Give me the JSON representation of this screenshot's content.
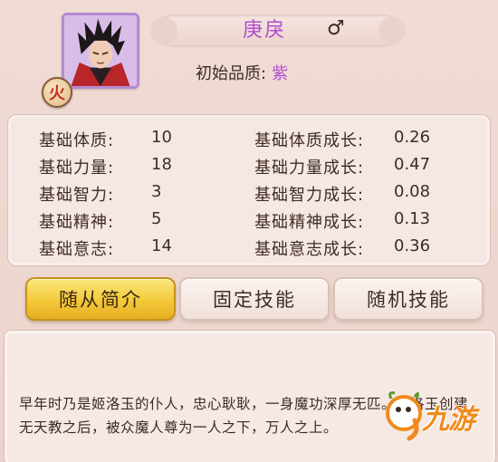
{
  "hero": {
    "name": "庚戾",
    "gender_symbol": "♂",
    "element_badge": "火",
    "quality_label": "初始品质:",
    "quality_value": "紫",
    "portrait_icon": "hero-portrait"
  },
  "stats": [
    {
      "label": "基础体质:",
      "value": "10",
      "growth_label": "基础体质成长:",
      "growth_value": "0.26"
    },
    {
      "label": "基础力量:",
      "value": "18",
      "growth_label": "基础力量成长:",
      "growth_value": "0.47"
    },
    {
      "label": "基础智力:",
      "value": "3",
      "growth_label": "基础智力成长:",
      "growth_value": "0.08"
    },
    {
      "label": "基础精神:",
      "value": "5",
      "growth_label": "基础精神成长:",
      "growth_value": "0.13"
    },
    {
      "label": "基础意志:",
      "value": "14",
      "growth_label": "基础意志成长:",
      "growth_value": "0.36"
    }
  ],
  "tabs": [
    {
      "label": "随从简介",
      "active": true
    },
    {
      "label": "固定技能",
      "active": false
    },
    {
      "label": "随机技能",
      "active": false
    }
  ],
  "description": "早年时乃是姬洛玉的仆人，忠心耿耿，一身魔功深厚无匹。姬洛玉创建无天教之后，被众魔人尊为一人之下，万人之上。",
  "watermark": {
    "text": "九游"
  },
  "colors": {
    "quality_purple": "#b14fcf",
    "tab_active": "#f3c93a",
    "watermark_orange": "#f08a1c"
  }
}
